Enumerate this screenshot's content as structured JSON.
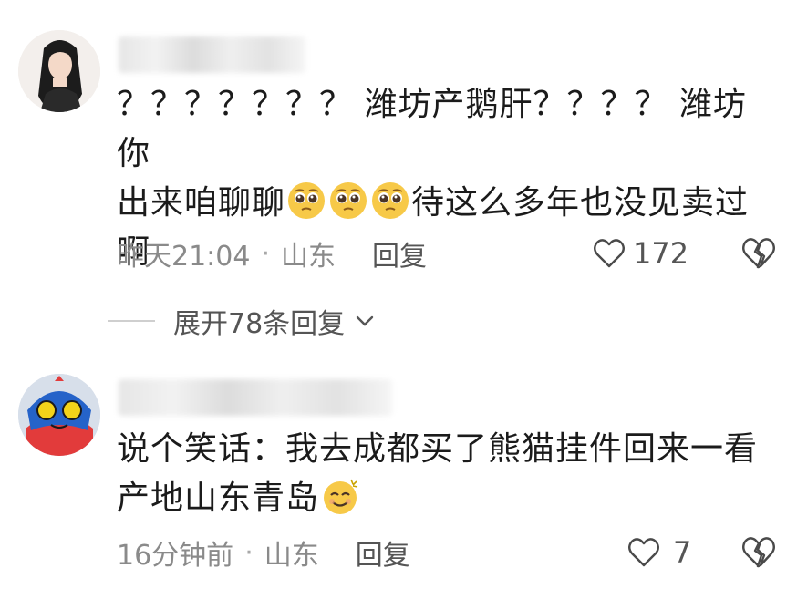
{
  "comments": [
    {
      "text_line1": "？？？？？？？ 潍坊产鹅肝？？？？ 潍坊你",
      "text_line2_a": "出来咱聊聊",
      "text_line2_b": "待这么多年也没见卖过",
      "text_line3": "啊",
      "emoji": [
        "pleading-face-icon",
        "pleading-face-icon",
        "pleading-face-icon"
      ],
      "time": "昨天21:04",
      "location": "山东",
      "reply_label": "回复",
      "likes": "172"
    },
    {
      "text_line1": "说个笑话：我去成都买了熊猫挂件回来一看",
      "text_line2": "产地山东青岛",
      "emoji": [
        "dizzy-smile-icon"
      ],
      "time": "16分钟前",
      "location": "山东",
      "reply_label": "回复",
      "likes": "7"
    }
  ],
  "expand_replies": {
    "label": "展开78条回复"
  },
  "separator": "·",
  "colors": {
    "text": "#1b1b1b",
    "meta": "#8a8a8a",
    "action": "#555555",
    "emoji_yellow": "#f7c948"
  }
}
